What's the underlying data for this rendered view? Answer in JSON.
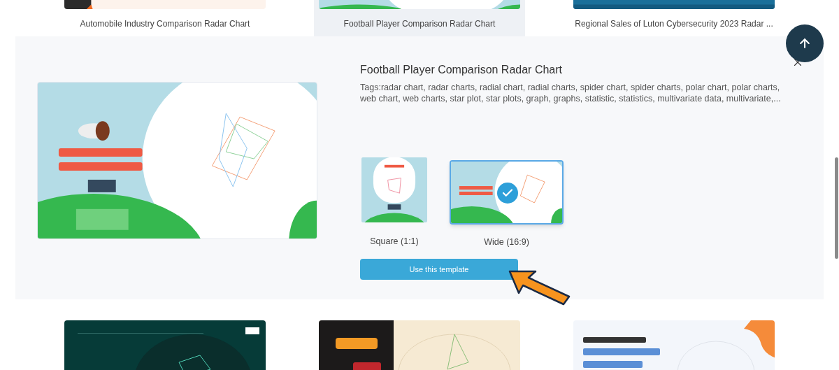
{
  "top_row": [
    {
      "title": "Automobile Industry Comparison Radar Chart",
      "selected": false
    },
    {
      "title": "Football Player Comparison Radar Chart",
      "selected": true
    },
    {
      "title": "Regional Sales of Luton Cybersecurity 2023 Radar ...",
      "selected": false
    }
  ],
  "detail": {
    "title": "Football Player Comparison Radar Chart",
    "tags": "Tags:radar chart, radar charts, radial chart, radial charts, spider chart, spider charts, polar chart, polar charts, web chart, web charts, star plot, star plots, graph, graphs, statistic, statistics, multivariate data, multivariate,...",
    "formats": [
      {
        "label": "Square (1:1)",
        "selected": false
      },
      {
        "label": "Wide (16:9)",
        "selected": true
      }
    ],
    "button": "Use this template"
  }
}
